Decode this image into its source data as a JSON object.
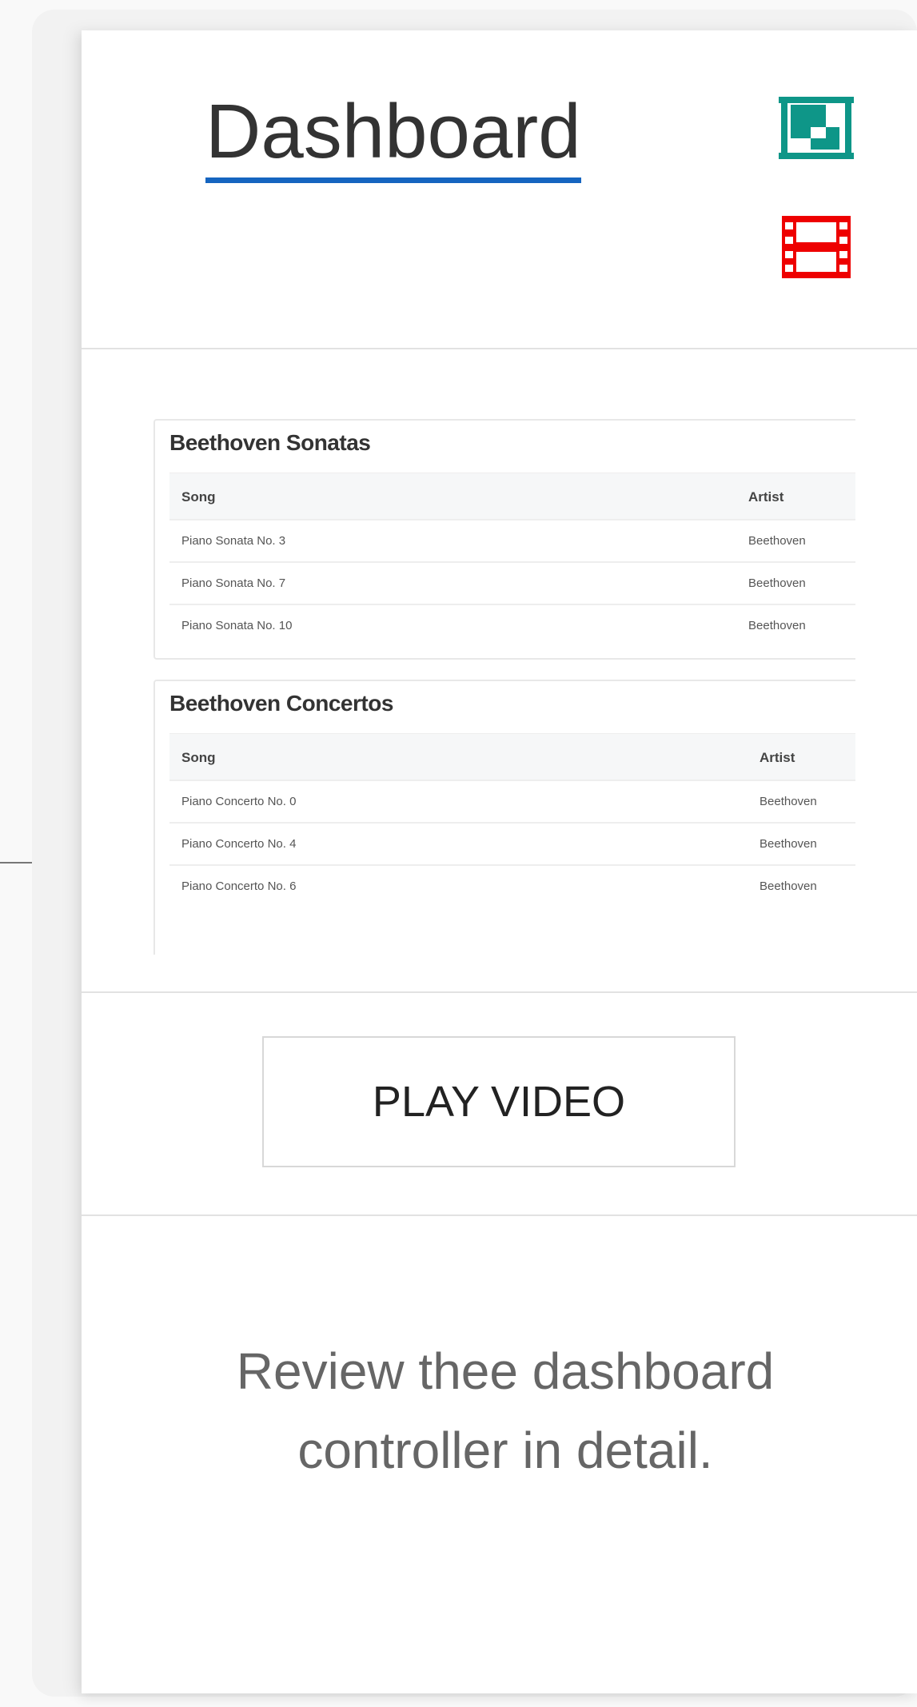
{
  "header": {
    "title": "Dashboard"
  },
  "icons": {
    "screenshot": {
      "name": "screenshot-icon",
      "color": "#0e9688"
    },
    "video": {
      "name": "film-icon",
      "color": "#ee0000"
    }
  },
  "preview": {
    "tables": [
      {
        "title": "Beethoven Sonatas",
        "columns": [
          "Song",
          "Artist"
        ],
        "rows": [
          [
            "Piano Sonata No. 3",
            "Beethoven"
          ],
          [
            "Piano Sonata No. 7",
            "Beethoven"
          ],
          [
            "Piano Sonata No. 10",
            "Beethoven"
          ]
        ]
      },
      {
        "title": "Beethoven Concertos",
        "columns": [
          "Song",
          "Artist"
        ],
        "rows": [
          [
            "Piano Concerto No. 0",
            "Beethoven"
          ],
          [
            "Piano Concerto No. 4",
            "Beethoven"
          ],
          [
            "Piano Concerto No. 6",
            "Beethoven"
          ]
        ]
      }
    ]
  },
  "play": {
    "label": "PLAY VIDEO"
  },
  "description": "Review thee dashboard controller in detail.",
  "colors": {
    "link_underline": "#1565c0",
    "text": "#333333"
  }
}
